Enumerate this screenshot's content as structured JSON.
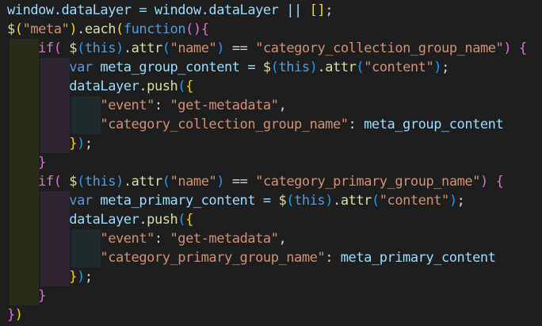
{
  "editor": {
    "language": "javascript",
    "theme": {
      "background": "#1e1e1e",
      "keyword": "#569cd6",
      "control": "#c586c0",
      "function": "#dcdcaa",
      "string": "#ce9178",
      "variable": "#9cdcfe",
      "bracket_level1": "#ffd700",
      "bracket_level2": "#da70d6",
      "bracket_level3": "#179fff",
      "indent_guide_1": "#2b2b1a",
      "indent_guide_2": "#2f2431",
      "indent_guide_3": "#1d2b2b"
    },
    "lines": [
      {
        "indent": 0,
        "tokens": [
          {
            "t": "window.dataLayer = window.dataLayer || ",
            "c": "var"
          },
          {
            "t": "[]",
            "c": "brk1"
          },
          {
            "t": ";",
            "c": "plain"
          }
        ]
      },
      {
        "indent": 0,
        "tokens": [
          {
            "t": "$",
            "c": "fn"
          },
          {
            "t": "(",
            "c": "brk1"
          },
          {
            "t": "\"meta\"",
            "c": "str"
          },
          {
            "t": ")",
            "c": "brk1"
          },
          {
            "t": ".",
            "c": "plain"
          },
          {
            "t": "each",
            "c": "fn"
          },
          {
            "t": "(",
            "c": "brk1"
          },
          {
            "t": "function",
            "c": "kw"
          },
          {
            "t": "()",
            "c": "brk2"
          },
          {
            "t": "{",
            "c": "brk2"
          }
        ]
      },
      {
        "indent": 1,
        "tokens": [
          {
            "t": "if",
            "c": "ctrl"
          },
          {
            "t": "( ",
            "c": "brk2"
          },
          {
            "t": "$",
            "c": "fn"
          },
          {
            "t": "(",
            "c": "brk3"
          },
          {
            "t": "this",
            "c": "kw"
          },
          {
            "t": ")",
            "c": "brk3"
          },
          {
            "t": ".",
            "c": "plain"
          },
          {
            "t": "attr",
            "c": "fn"
          },
          {
            "t": "(",
            "c": "brk3"
          },
          {
            "t": "\"name\"",
            "c": "str"
          },
          {
            "t": ")",
            "c": "brk3"
          },
          {
            "t": " == ",
            "c": "plain"
          },
          {
            "t": "\"category_collection_group_name\"",
            "c": "str"
          },
          {
            "t": ")",
            "c": "brk2"
          },
          {
            "t": " ",
            "c": "plain"
          },
          {
            "t": "{",
            "c": "brk2"
          }
        ]
      },
      {
        "indent": 2,
        "tokens": [
          {
            "t": "var",
            "c": "kw"
          },
          {
            "t": " meta_group_content = ",
            "c": "var"
          },
          {
            "t": "$",
            "c": "fn"
          },
          {
            "t": "(",
            "c": "brk3"
          },
          {
            "t": "this",
            "c": "kw"
          },
          {
            "t": ")",
            "c": "brk3"
          },
          {
            "t": ".",
            "c": "plain"
          },
          {
            "t": "attr",
            "c": "fn"
          },
          {
            "t": "(",
            "c": "brk3"
          },
          {
            "t": "\"content\"",
            "c": "str"
          },
          {
            "t": ")",
            "c": "brk3"
          },
          {
            "t": ";",
            "c": "plain"
          }
        ]
      },
      {
        "indent": 2,
        "tokens": [
          {
            "t": "dataLayer",
            "c": "var"
          },
          {
            "t": ".",
            "c": "plain"
          },
          {
            "t": "push",
            "c": "fn"
          },
          {
            "t": "(",
            "c": "brk3"
          },
          {
            "t": "{",
            "c": "brk1"
          }
        ]
      },
      {
        "indent": 3,
        "tokens": [
          {
            "t": "\"event\"",
            "c": "str"
          },
          {
            "t": ": ",
            "c": "plain"
          },
          {
            "t": "\"get-metadata\"",
            "c": "str"
          },
          {
            "t": ",",
            "c": "plain"
          }
        ]
      },
      {
        "indent": 3,
        "tokens": [
          {
            "t": "\"category_collection_group_name\"",
            "c": "str"
          },
          {
            "t": ": ",
            "c": "plain"
          },
          {
            "t": "meta_group_content",
            "c": "var"
          }
        ]
      },
      {
        "indent": 2,
        "tokens": [
          {
            "t": "}",
            "c": "brk1"
          },
          {
            "t": ")",
            "c": "brk3"
          },
          {
            "t": ";",
            "c": "plain"
          }
        ]
      },
      {
        "indent": 1,
        "tokens": [
          {
            "t": "}",
            "c": "brk2"
          }
        ]
      },
      {
        "indent": 1,
        "tokens": [
          {
            "t": "if",
            "c": "ctrl"
          },
          {
            "t": "( ",
            "c": "brk2"
          },
          {
            "t": "$",
            "c": "fn"
          },
          {
            "t": "(",
            "c": "brk3"
          },
          {
            "t": "this",
            "c": "kw"
          },
          {
            "t": ")",
            "c": "brk3"
          },
          {
            "t": ".",
            "c": "plain"
          },
          {
            "t": "attr",
            "c": "fn"
          },
          {
            "t": "(",
            "c": "brk3"
          },
          {
            "t": "\"name\"",
            "c": "str"
          },
          {
            "t": ")",
            "c": "brk3"
          },
          {
            "t": " == ",
            "c": "plain"
          },
          {
            "t": "\"category_primary_group_name\"",
            "c": "str"
          },
          {
            "t": ")",
            "c": "brk2"
          },
          {
            "t": " ",
            "c": "plain"
          },
          {
            "t": "{",
            "c": "brk2"
          }
        ]
      },
      {
        "indent": 2,
        "tokens": [
          {
            "t": "var",
            "c": "kw"
          },
          {
            "t": " meta_primary_content = ",
            "c": "var"
          },
          {
            "t": "$",
            "c": "fn"
          },
          {
            "t": "(",
            "c": "brk3"
          },
          {
            "t": "this",
            "c": "kw"
          },
          {
            "t": ")",
            "c": "brk3"
          },
          {
            "t": ".",
            "c": "plain"
          },
          {
            "t": "attr",
            "c": "fn"
          },
          {
            "t": "(",
            "c": "brk3"
          },
          {
            "t": "\"content\"",
            "c": "str"
          },
          {
            "t": ")",
            "c": "brk3"
          },
          {
            "t": ";",
            "c": "plain"
          }
        ]
      },
      {
        "indent": 2,
        "tokens": [
          {
            "t": "dataLayer",
            "c": "var"
          },
          {
            "t": ".",
            "c": "plain"
          },
          {
            "t": "push",
            "c": "fn"
          },
          {
            "t": "(",
            "c": "brk3"
          },
          {
            "t": "{",
            "c": "brk1"
          }
        ]
      },
      {
        "indent": 3,
        "tokens": [
          {
            "t": "\"event\"",
            "c": "str"
          },
          {
            "t": ": ",
            "c": "plain"
          },
          {
            "t": "\"get-metadata\"",
            "c": "str"
          },
          {
            "t": ",",
            "c": "plain"
          }
        ]
      },
      {
        "indent": 3,
        "tokens": [
          {
            "t": "\"category_primary_group_name\"",
            "c": "str"
          },
          {
            "t": ": ",
            "c": "plain"
          },
          {
            "t": "meta_primary_content",
            "c": "var"
          }
        ]
      },
      {
        "indent": 2,
        "tokens": [
          {
            "t": "}",
            "c": "brk1"
          },
          {
            "t": ")",
            "c": "brk3"
          },
          {
            "t": ";",
            "c": "plain"
          }
        ]
      },
      {
        "indent": 1,
        "tokens": [
          {
            "t": "}",
            "c": "brk2"
          }
        ]
      },
      {
        "indent": 0,
        "tokens": [
          {
            "t": "}",
            "c": "brk2"
          },
          {
            "t": ")",
            "c": "brk1"
          }
        ]
      }
    ]
  }
}
